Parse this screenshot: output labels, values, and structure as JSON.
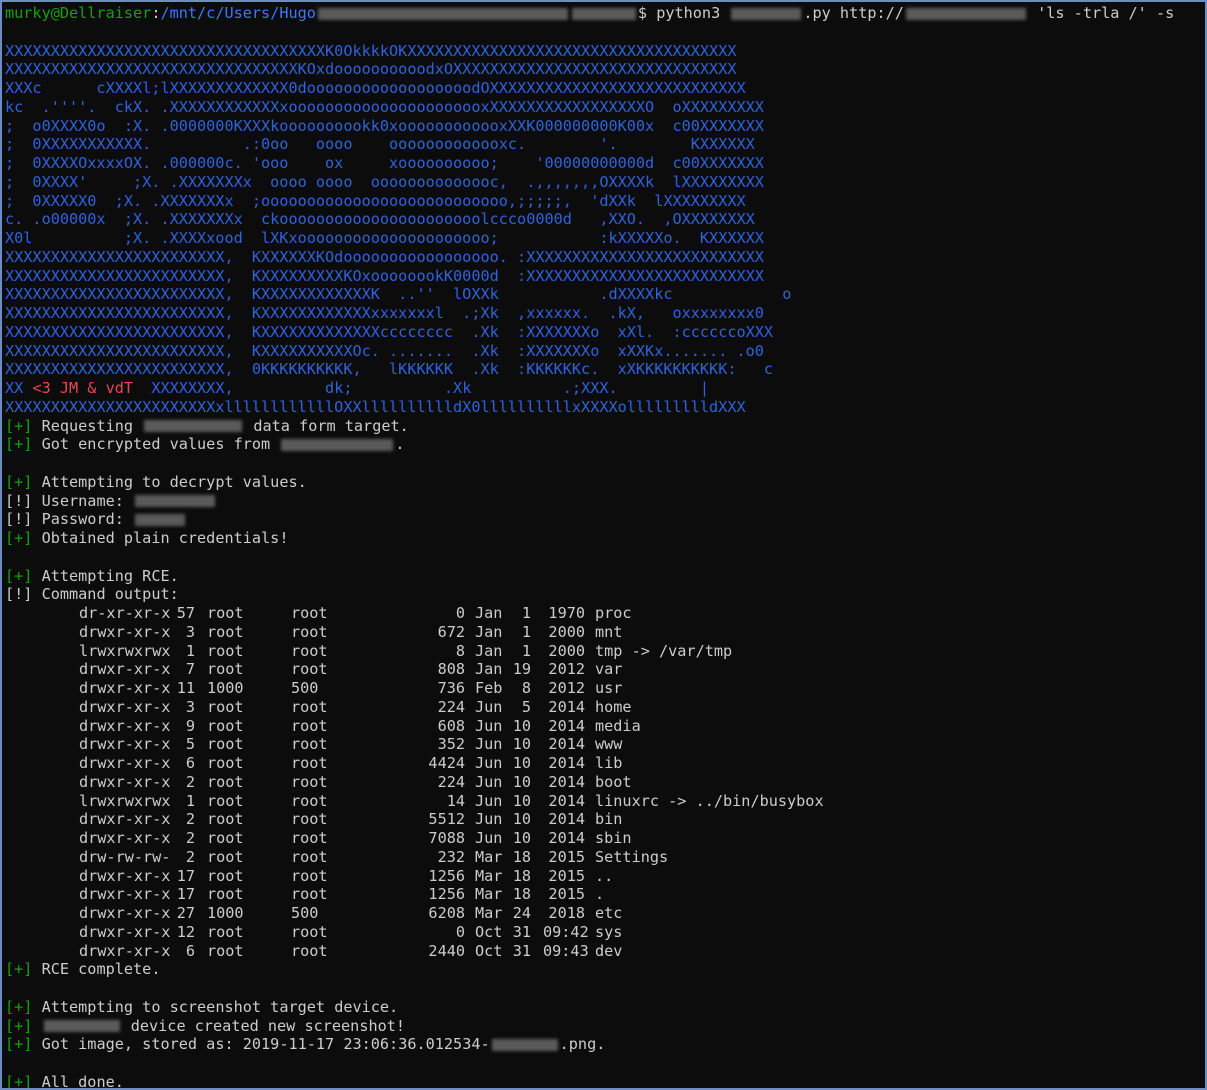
{
  "prompt": {
    "user_host": "murky@Dellraiser",
    "path": "/mnt/c/Users/Hugo",
    "cmd_a": "$ python3 ",
    "cmd_b": ".py http://",
    "cmd_c": " 'ls -trla /' -s"
  },
  "banner": [
    "XXXXXXXXXXXXXXXXXXXXXXXXXXXXXXXXXXXK0OkkkkOKXXXXXXXXXXXXXXXXXXXXXXXXXXXXXXXXXXXX",
    "XXXXXXXXXXXXXXXXXXXXXXXXXXXXXXXXKOxdoooooooooodxOXXXXXXXXXXXXXXXXXXXXXXXXXXXXXXX",
    "XXXc      cXXXXl;lXXXXXXXXXXXXX0doooooooooooooooooodOXXXXXXXXXXXXXXXXXXXXXXXXXXXX",
    "kc  .''''.  ckX. .XXXXXXXXXXXXxoooooooooooooooooooooxXXXXXXXXXXXXXXXXXO  oXXXXXXXXX",
    ";  o0XXXX0o  :X. .0000000KXXXkoooooooookk0xoooooooooooxXXK000000000K00x  c00XXXXXXX",
    ";  0XXXXXXXXXXX.          .:0oo   oooo    ooooooooooooxc.        '.        KXXXXXX",
    ";  0XXXXOxxxxOX. .000000c. 'ooo    ox     xoooooooooo;    '00000000000d  c00XXXXXXX",
    ";  0XXXX'     ;X. .XXXXXXXx  oooo oooo  oooooooooooooc,  .,,,,,,,OXXXXk  lXXXXXXXXX",
    ";  0XXXXX0  ;X. .XXXXXXXx  ;ooooooooooooooooooooooooooo,;;;;;,  'dXXk  lXXXXXXXXX",
    "c. .o00000x  ;X. .XXXXXXXx  ckoooooooooooooooooooooolccco0000d   ,XXO.  ,OXXXXXXXX",
    "X0l          ;X. .XXXXxood  lXKxooooooooooooooooooooo;           :kXXXXXo.  KXXXXXX",
    "XXXXXXXXXXXXXXXXXXXXXXXX,  KXXXXXXKOdooooooooooooooooo. :XXXXXXXXXXXXXXXXXXXXXXXXXX",
    "XXXXXXXXXXXXXXXXXXXXXXXX,  KXXXXXXXXXKOxoooooookK0000d  :XXXXXXXXXXXXXXXXXXXXXXXXXX",
    "XXXXXXXXXXXXXXXXXXXXXXXX,  KXXXXXXXXXXXXK  ..''  lOXXk           .dXXXXkc            o",
    "XXXXXXXXXXXXXXXXXXXXXXXX,  KXXXXXXXXXXXXxxxxxxxl  .;Xk  ,xxxxxx.  .kX,   oxxxxxxxx0",
    "XXXXXXXXXXXXXXXXXXXXXXXX,  KXXXXXXXXXXXXXcccccccc  .Xk  :XXXXXXXo  xXl.  :ccccccoXXX",
    "XXXXXXXXXXXXXXXXXXXXXXXX,  KXXXXXXXXXXOc. .......  .Xk  :XXXXXXXo  xXXKx....... .o0",
    "XXXXXXXXXXXXXXXXXXXXXXXX,  0KKKKKKKKKK,   lKKKKKK  .Xk  :KKKKKKc.  xXKKKKKKKKKK:   c"
  ],
  "banner_sig": {
    "a": "XX ",
    "b": "<3 JM & vdT",
    "c": "  XXXXXXXX,          dk;          .Xk          .;XXX.         |"
  },
  "banner_last": "XXXXXXXXXXXXXXXXXXXXXXXxllllllllllllOXXlllllllllldX0llllllllllxXXXXollllllllldXXX",
  "log": {
    "requesting_a": "[+] ",
    "requesting_b": "Requesting ",
    "requesting_c": " data form target.",
    "got_values_a": "Got encrypted values from ",
    "got_values_b": ".",
    "attempt_decrypt": "Attempting to decrypt values.",
    "username": "Username: ",
    "password": "Password: ",
    "obtained": "Obtained plain credentials!",
    "attempt_rce": "Attempting RCE.",
    "command_output": "Command output:",
    "rce_complete": "RCE complete.",
    "attempt_screenshot": "Attempting to screenshot target device.",
    "created_screenshot": " device created new screenshot!",
    "got_image_a": "Got image, stored as: 2019-11-17 23:06:36.012534-",
    "got_image_b": ".png.",
    "all_done": "All done.",
    "plus": "[+]",
    "bang": "[!]"
  },
  "ls_rows": [
    {
      "perm": "dr-xr-xr-x",
      "links": "57",
      "owner": "root",
      "group": "root",
      "size": "0",
      "mon": "Jan",
      "day": "1",
      "time": "1970",
      "name": "proc"
    },
    {
      "perm": "drwxr-xr-x",
      "links": "3",
      "owner": "root",
      "group": "root",
      "size": "672",
      "mon": "Jan",
      "day": "1",
      "time": "2000",
      "name": "mnt"
    },
    {
      "perm": "lrwxrwxrwx",
      "links": "1",
      "owner": "root",
      "group": "root",
      "size": "8",
      "mon": "Jan",
      "day": "1",
      "time": "2000",
      "name": "tmp -> /var/tmp"
    },
    {
      "perm": "drwxr-xr-x",
      "links": "7",
      "owner": "root",
      "group": "root",
      "size": "808",
      "mon": "Jan",
      "day": "19",
      "time": "2012",
      "name": "var"
    },
    {
      "perm": "drwxr-xr-x",
      "links": "11",
      "owner": "1000",
      "group": "500",
      "size": "736",
      "mon": "Feb",
      "day": "8",
      "time": "2012",
      "name": "usr"
    },
    {
      "perm": "drwxr-xr-x",
      "links": "3",
      "owner": "root",
      "group": "root",
      "size": "224",
      "mon": "Jun",
      "day": "5",
      "time": "2014",
      "name": "home"
    },
    {
      "perm": "drwxr-xr-x",
      "links": "9",
      "owner": "root",
      "group": "root",
      "size": "608",
      "mon": "Jun",
      "day": "10",
      "time": "2014",
      "name": "media"
    },
    {
      "perm": "drwxr-xr-x",
      "links": "5",
      "owner": "root",
      "group": "root",
      "size": "352",
      "mon": "Jun",
      "day": "10",
      "time": "2014",
      "name": "www"
    },
    {
      "perm": "drwxr-xr-x",
      "links": "6",
      "owner": "root",
      "group": "root",
      "size": "4424",
      "mon": "Jun",
      "day": "10",
      "time": "2014",
      "name": "lib"
    },
    {
      "perm": "drwxr-xr-x",
      "links": "2",
      "owner": "root",
      "group": "root",
      "size": "224",
      "mon": "Jun",
      "day": "10",
      "time": "2014",
      "name": "boot"
    },
    {
      "perm": "lrwxrwxrwx",
      "links": "1",
      "owner": "root",
      "group": "root",
      "size": "14",
      "mon": "Jun",
      "day": "10",
      "time": "2014",
      "name": "linuxrc -> ../bin/busybox"
    },
    {
      "perm": "drwxr-xr-x",
      "links": "2",
      "owner": "root",
      "group": "root",
      "size": "5512",
      "mon": "Jun",
      "day": "10",
      "time": "2014",
      "name": "bin"
    },
    {
      "perm": "drwxr-xr-x",
      "links": "2",
      "owner": "root",
      "group": "root",
      "size": "7088",
      "mon": "Jun",
      "day": "10",
      "time": "2014",
      "name": "sbin"
    },
    {
      "perm": "drw-rw-rw-",
      "links": "2",
      "owner": "root",
      "group": "root",
      "size": "232",
      "mon": "Mar",
      "day": "18",
      "time": "2015",
      "name": "Settings"
    },
    {
      "perm": "drwxr-xr-x",
      "links": "17",
      "owner": "root",
      "group": "root",
      "size": "1256",
      "mon": "Mar",
      "day": "18",
      "time": "2015",
      "name": ".."
    },
    {
      "perm": "drwxr-xr-x",
      "links": "17",
      "owner": "root",
      "group": "root",
      "size": "1256",
      "mon": "Mar",
      "day": "18",
      "time": "2015",
      "name": "."
    },
    {
      "perm": "drwxr-xr-x",
      "links": "27",
      "owner": "1000",
      "group": "500",
      "size": "6208",
      "mon": "Mar",
      "day": "24",
      "time": "2018",
      "name": "etc"
    },
    {
      "perm": "drwxr-xr-x",
      "links": "12",
      "owner": "root",
      "group": "root",
      "size": "0",
      "mon": "Oct",
      "day": "31",
      "time": "09:42",
      "name": "sys"
    },
    {
      "perm": "drwxr-xr-x",
      "links": "6",
      "owner": "root",
      "group": "root",
      "size": "2440",
      "mon": "Oct",
      "day": "31",
      "time": "09:43",
      "name": "dev"
    }
  ],
  "colors": {
    "background": "#0c0c0c",
    "text": "#cccccc",
    "prompt_green": "#13a10e",
    "path_blue": "#3b78ff",
    "banner_blue": "#2f62dd",
    "banner_red": "#e74856",
    "window_border": "#6d8cc4"
  }
}
